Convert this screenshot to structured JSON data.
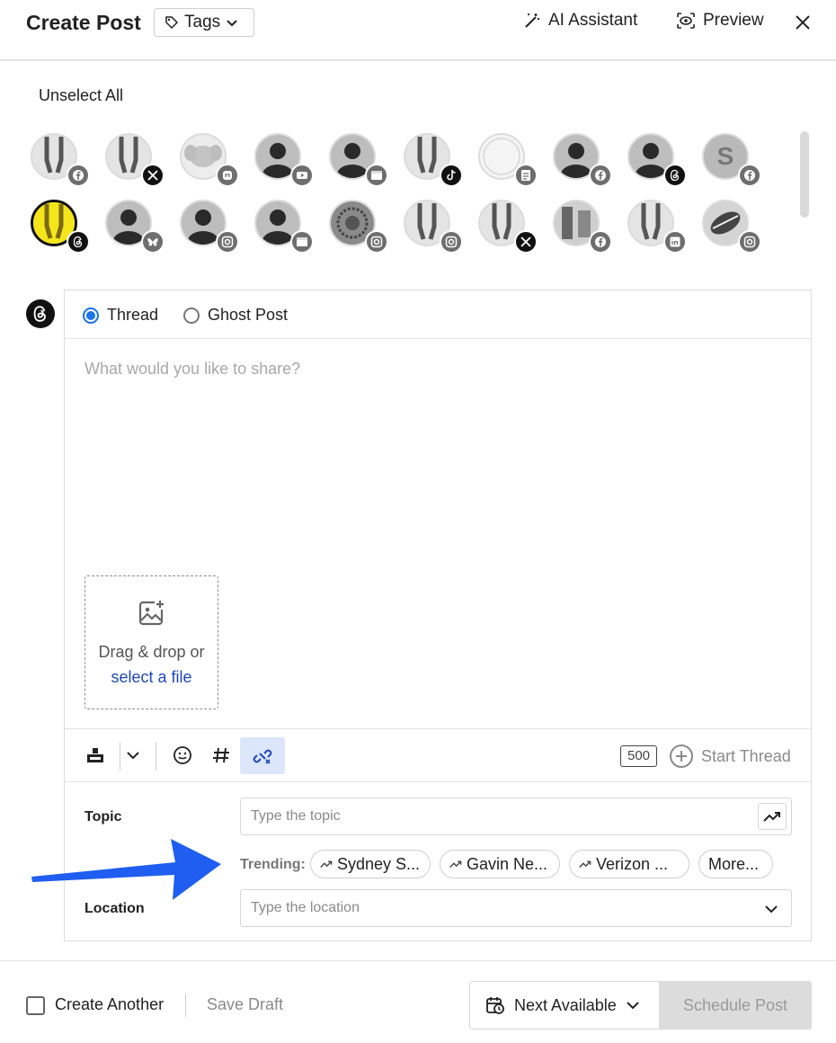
{
  "header": {
    "title": "Create Post",
    "tags_label": "Tags",
    "ai_label": "AI Assistant",
    "preview_label": "Preview"
  },
  "accounts": {
    "unselect_label": "Unselect All",
    "letter_avatar": "S"
  },
  "composer": {
    "type_options": [
      "Thread",
      "Ghost Post"
    ],
    "selected_type": "Thread",
    "placeholder": "What would you like to share?",
    "dropzone_text": "Drag & drop or",
    "dropzone_link": "select a file",
    "char_count": "500",
    "start_thread_label": "Start Thread"
  },
  "topic": {
    "label": "Topic",
    "placeholder": "Type the topic",
    "trending_label": "Trending:",
    "trending": [
      "Sydney S...",
      "Gavin Ne...",
      "Verizon ..."
    ],
    "more_label": "More..."
  },
  "location": {
    "label": "Location",
    "placeholder": "Type the location"
  },
  "footer": {
    "create_another_label": "Create Another",
    "save_draft_label": "Save Draft",
    "next_available_label": "Next Available",
    "schedule_label": "Schedule Post"
  },
  "colors": {
    "accent": "#1a73e8",
    "link": "#1f47b8",
    "annotation_arrow": "#1f5ef0"
  }
}
